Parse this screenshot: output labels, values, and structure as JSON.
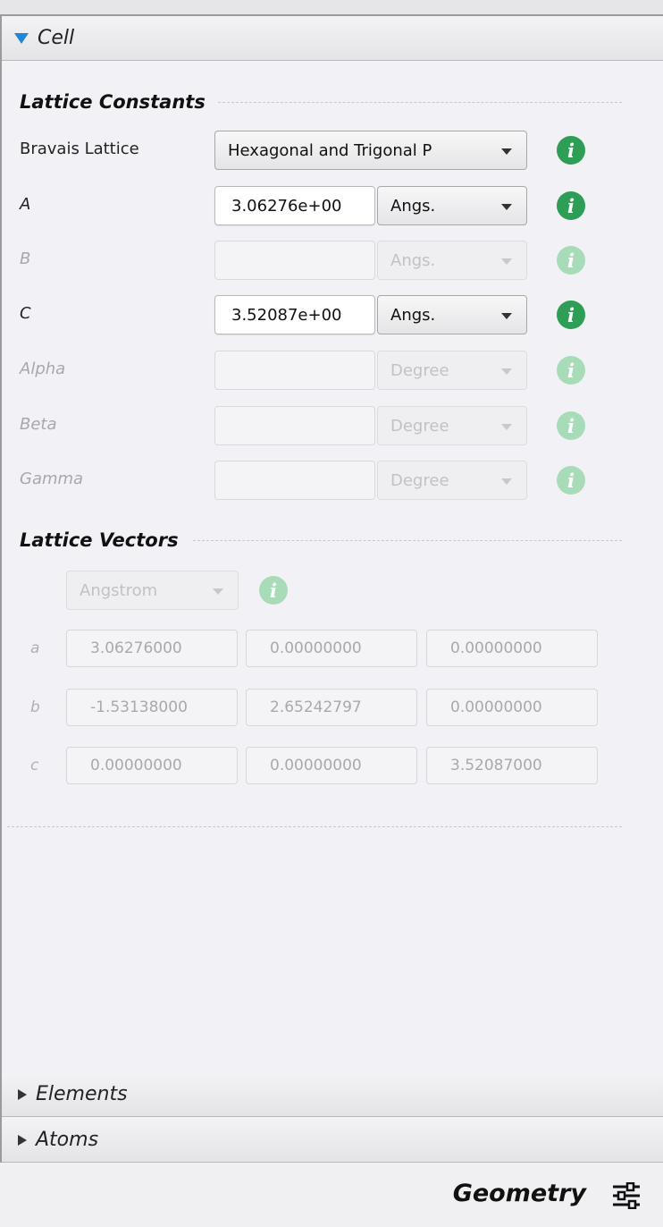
{
  "cell_section": {
    "title": "Cell"
  },
  "lattice_constants": {
    "title": "Lattice Constants",
    "bravais_label": "Bravais Lattice",
    "bravais_value": "Hexagonal and Trigonal P",
    "rows": [
      {
        "label": "A",
        "value": "3.06276e+00",
        "unit": "Angs."
      },
      {
        "label": "B",
        "value": "",
        "unit": "Angs."
      },
      {
        "label": "C",
        "value": "3.52087e+00",
        "unit": "Angs."
      },
      {
        "label": "Alpha",
        "value": "",
        "unit": "Degree"
      },
      {
        "label": "Beta",
        "value": "",
        "unit": "Degree"
      },
      {
        "label": "Gamma",
        "value": "",
        "unit": "Degree"
      }
    ]
  },
  "lattice_vectors": {
    "title": "Lattice Vectors",
    "unit": "Angstrom",
    "rows": [
      {
        "label": "a",
        "values": [
          "3.06276000",
          "0.00000000",
          "0.00000000"
        ]
      },
      {
        "label": "b",
        "values": [
          "-1.53138000",
          "2.65242797",
          "0.00000000"
        ]
      },
      {
        "label": "c",
        "values": [
          "0.00000000",
          "0.00000000",
          "3.52087000"
        ]
      }
    ]
  },
  "sections": {
    "elements": "Elements",
    "atoms": "Atoms"
  },
  "footer": {
    "title": "Geometry"
  },
  "colors": {
    "info_enabled": "#2e9e57",
    "info_disabled": "#a8dcb9",
    "expand_arrow": "#1e88d6"
  },
  "icons": {
    "expand": "triangle-down-icon",
    "collapsed": "triangle-right-icon",
    "info": "info-icon",
    "settings": "sliders-icon"
  }
}
